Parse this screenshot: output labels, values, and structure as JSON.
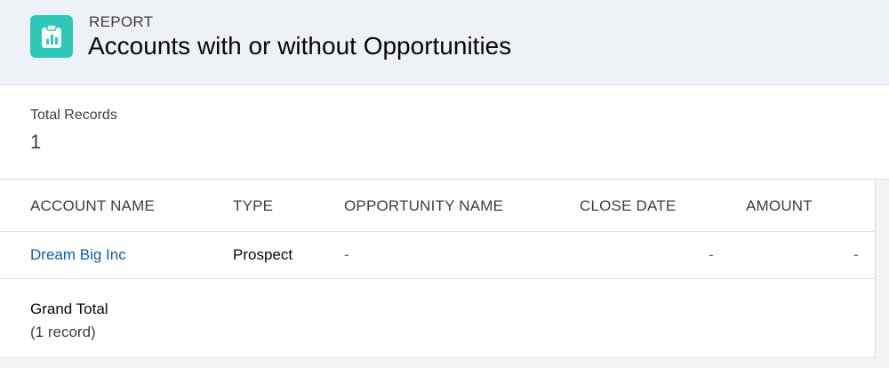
{
  "header": {
    "kicker": "REPORT",
    "title": "Accounts with or without Opportunities",
    "icon": "report-icon",
    "accent_color": "#2dc8b7"
  },
  "summary": {
    "label": "Total Records",
    "value": "1"
  },
  "table": {
    "columns": [
      "ACCOUNT NAME",
      "TYPE",
      "OPPORTUNITY NAME",
      "CLOSE DATE",
      "AMOUNT"
    ],
    "rows": [
      {
        "account_name": "Dream Big Inc",
        "type": "Prospect",
        "opportunity_name": "-",
        "close_date": "-",
        "amount": "-"
      }
    ],
    "grand_total": {
      "label": "Grand Total",
      "count": "(1 record)"
    }
  }
}
